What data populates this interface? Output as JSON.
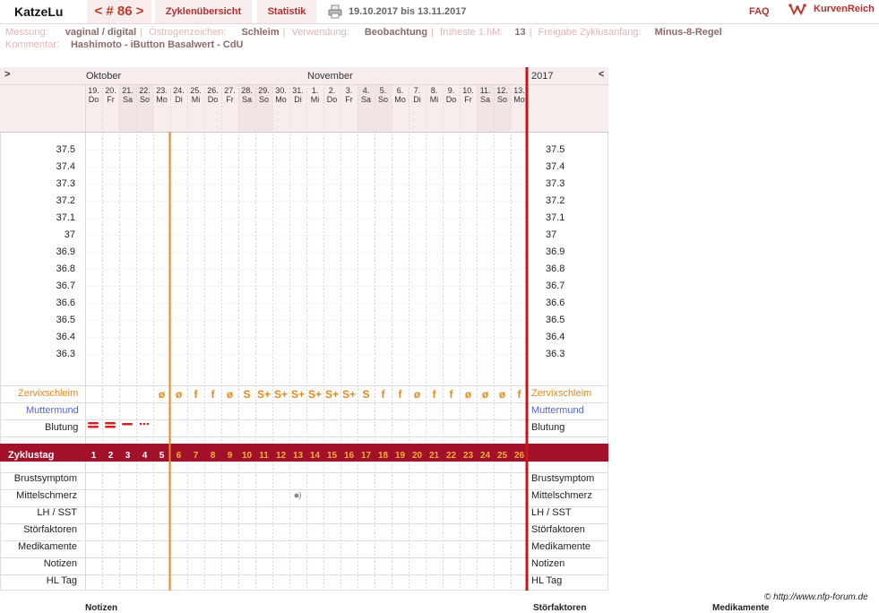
{
  "header": {
    "user": "KatzeLu",
    "cycle": "< # 86 >",
    "tabs": [
      "Zyklenübersicht",
      "Statistik"
    ],
    "date_range": "19.10.2017 bis 13.11.2017",
    "faq": "FAQ",
    "brand": "KurvenReich"
  },
  "info": {
    "messung_label": "Messung:",
    "messung": "vaginal / digital",
    "oestrogen_label": "Östrogenzeichen:",
    "oestrogen": "Schleim",
    "verwendung_label": "Verwendung:",
    "verwendung": "Beobachtung",
    "fhm_label": "früheste 1.hM:",
    "fhm": "13",
    "freigabe_label": "Freigabe Zyklusanfang:",
    "freigabe": "Minus-8-Regel",
    "kommentar_label": "Kommentar:",
    "kommentar": "Hashimoto - iButton Basalwert - CdU"
  },
  "chart": {
    "nav_prev": ">",
    "nav_next": "<",
    "month1": "Oktober",
    "month2": "November",
    "year": "2017",
    "days": [
      "19.",
      "20.",
      "21.",
      "22.",
      "23.",
      "24.",
      "25.",
      "26.",
      "27.",
      "28.",
      "29.",
      "30.",
      "31.",
      "1.",
      "2.",
      "3.",
      "4.",
      "5.",
      "6.",
      "7.",
      "8.",
      "9.",
      "10.",
      "11.",
      "12.",
      "13."
    ],
    "weekdays": [
      "Do",
      "Fr",
      "Sa",
      "So",
      "Mo",
      "Di",
      "Mi",
      "Do",
      "Fr",
      "Sa",
      "So",
      "Mo",
      "Di",
      "Mi",
      "Do",
      "Fr",
      "Sa",
      "So",
      "Mo",
      "Di",
      "Mi",
      "Do",
      "Fr",
      "Sa",
      "So",
      "Mo"
    ],
    "temp_ticks": [
      "37.5",
      "37.4",
      "37.3",
      "37.2",
      "37.1",
      "37",
      "36.9",
      "36.8",
      "36.7",
      "36.6",
      "36.5",
      "36.4",
      "36.3"
    ],
    "zervix_label": "Zervixschleim",
    "zervix": [
      "",
      "",
      "",
      "",
      "ø",
      "ø",
      "f",
      "f",
      "ø",
      "S",
      "S+",
      "S+",
      "S+",
      "S+",
      "S+",
      "S+",
      "S",
      "f",
      "f",
      "ø",
      "f",
      "f",
      "ø",
      "ø",
      "ø",
      "f"
    ],
    "muttermund_label": "Muttermund",
    "blutung_label": "Blutung",
    "zyklustag_label": "Zyklustag",
    "zyklustage": [
      "1",
      "2",
      "3",
      "4",
      "5",
      "6",
      "7",
      "8",
      "9",
      "10",
      "11",
      "12",
      "13",
      "14",
      "15",
      "16",
      "17",
      "18",
      "19",
      "20",
      "21",
      "22",
      "23",
      "24",
      "25",
      "26"
    ],
    "bottom_rows": [
      "Brustsymptom",
      "Mittelschmerz",
      "LH / SST",
      "Störfaktoren",
      "Medikamente",
      "Notizen",
      "HL Tag"
    ],
    "mittelschmerz_day_index": 12
  },
  "footer": {
    "credit": "© http://www.nfp-forum.de",
    "notizen": "Notizen",
    "stoerfaktoren": "Störfaktoren",
    "medikamente": "Medikamente"
  },
  "colors": {
    "accent": "#a3102a",
    "orange": "#e6891e",
    "muttermund": "#5566cc",
    "blood": "#d42020",
    "weekend": "#f3e4e4"
  }
}
